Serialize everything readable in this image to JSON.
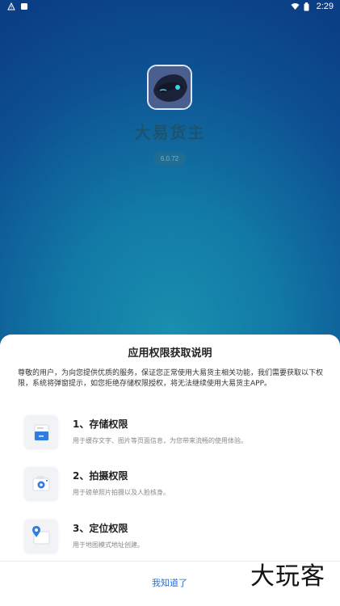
{
  "status_bar": {
    "time": "2:29",
    "icons": [
      "warning-icon",
      "notification-icon",
      "wifi-icon",
      "battery-icon"
    ]
  },
  "app": {
    "name": "大易货主",
    "version": "6.0.72",
    "icon": "robot-mask-logo"
  },
  "dialog": {
    "title": "应用权限获取说明",
    "intro": "尊敬的用户，为向您提供优质的服务，保证您正常使用大易货主相关功能，我们需要获取以下权限，系统将弹窗提示，如您拒绝存储权限授权，将无法继续使用大易货主APP。",
    "permissions": [
      {
        "title": "1、存储权限",
        "desc": "用于缓存文字、图片等页面信息，为您带来流畅的使用体验。",
        "icon": "storage-icon"
      },
      {
        "title": "2、拍摄权限",
        "desc": "用于磅单照片拍摄以及人脸核身。",
        "icon": "camera-icon"
      },
      {
        "title": "3、定位权限",
        "desc": "用于地图模式地址创建。",
        "icon": "location-icon"
      }
    ],
    "confirm_label": "我知道了"
  },
  "watermark": "大玩客",
  "colors": {
    "accent": "#2a6fd6",
    "background_top": "#1a8fae",
    "background_bottom": "#0b3f85"
  }
}
